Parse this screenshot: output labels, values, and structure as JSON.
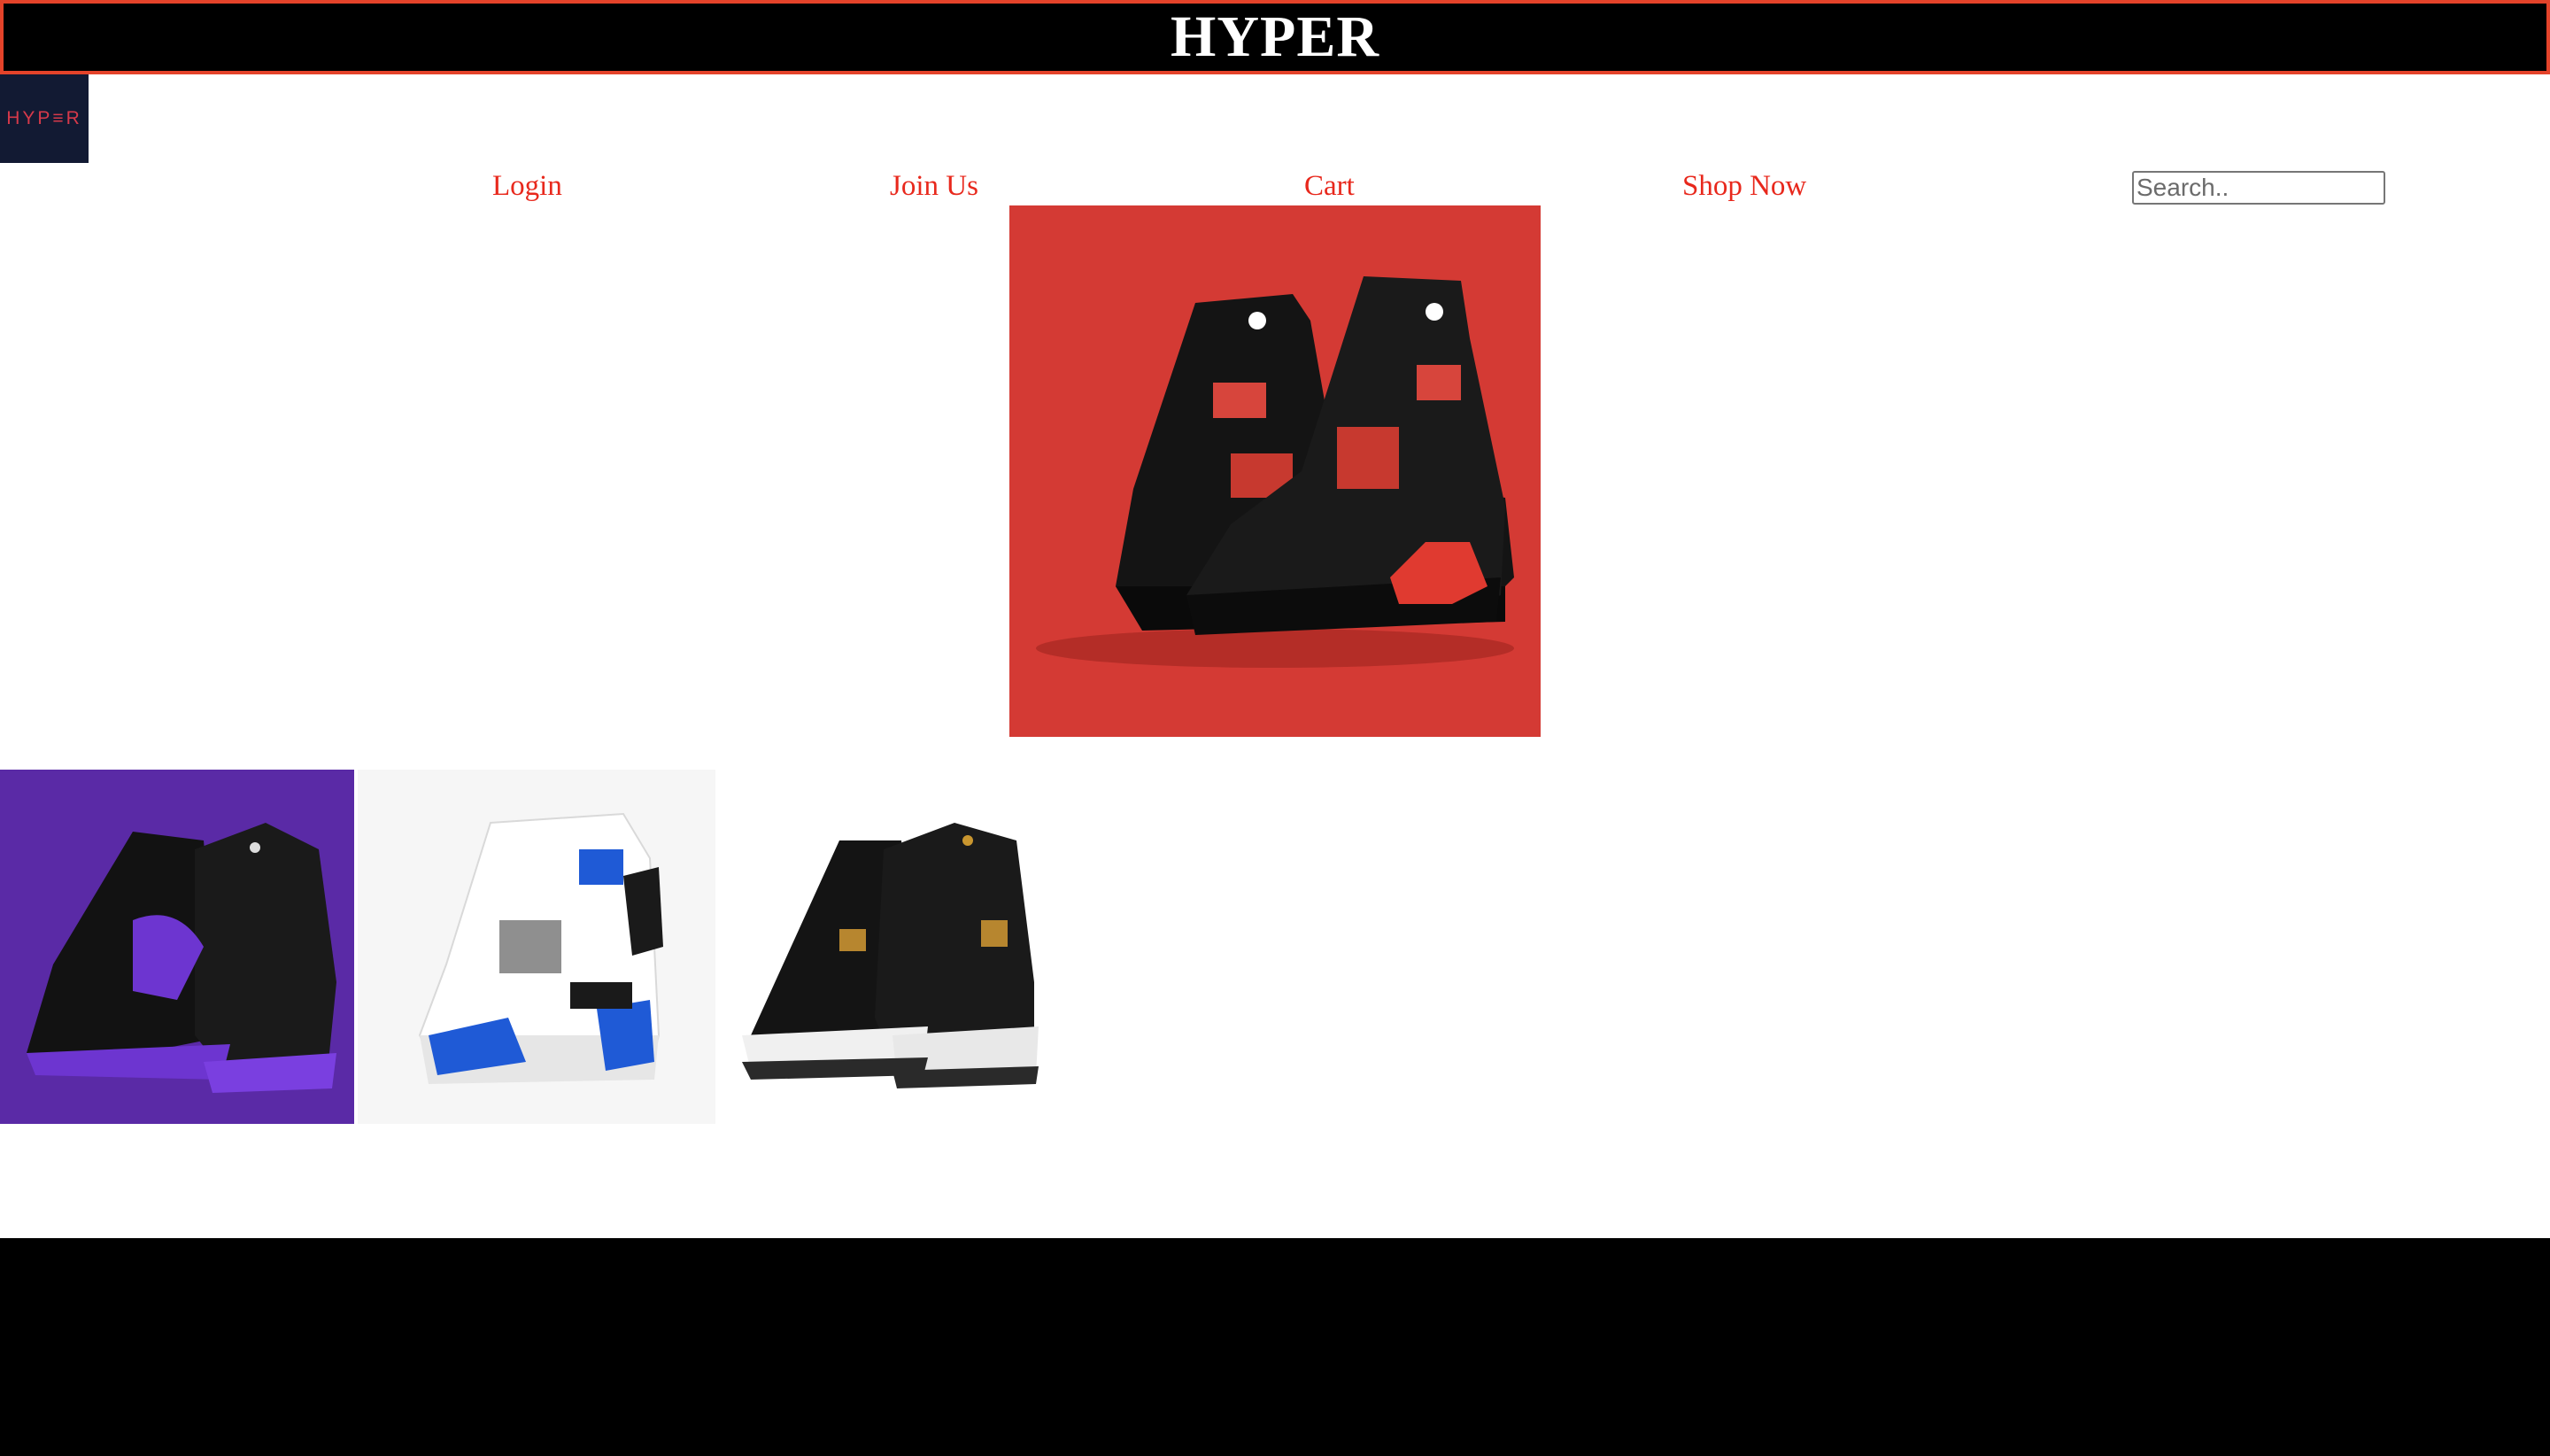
{
  "header": {
    "title": "HYPER"
  },
  "logo": {
    "text": "HYP≡R"
  },
  "nav": {
    "login": "Login",
    "join": "Join Us",
    "cart": "Cart",
    "shop": "Shop Now"
  },
  "search": {
    "placeholder": "Search..",
    "value": ""
  },
  "hero": {
    "image": "red-black-sneakers-icon"
  },
  "products": [
    {
      "image": "purple-black-sneakers-icon"
    },
    {
      "image": "white-blue-sneaker-icon"
    },
    {
      "image": "black-gold-sneakers-icon"
    }
  ],
  "colors": {
    "accent": "#e8281c",
    "header_border": "#e4432a",
    "hero_bg": "#d43a34",
    "tile_purple": "#5a2aa6",
    "logo_bg": "#121a33"
  }
}
